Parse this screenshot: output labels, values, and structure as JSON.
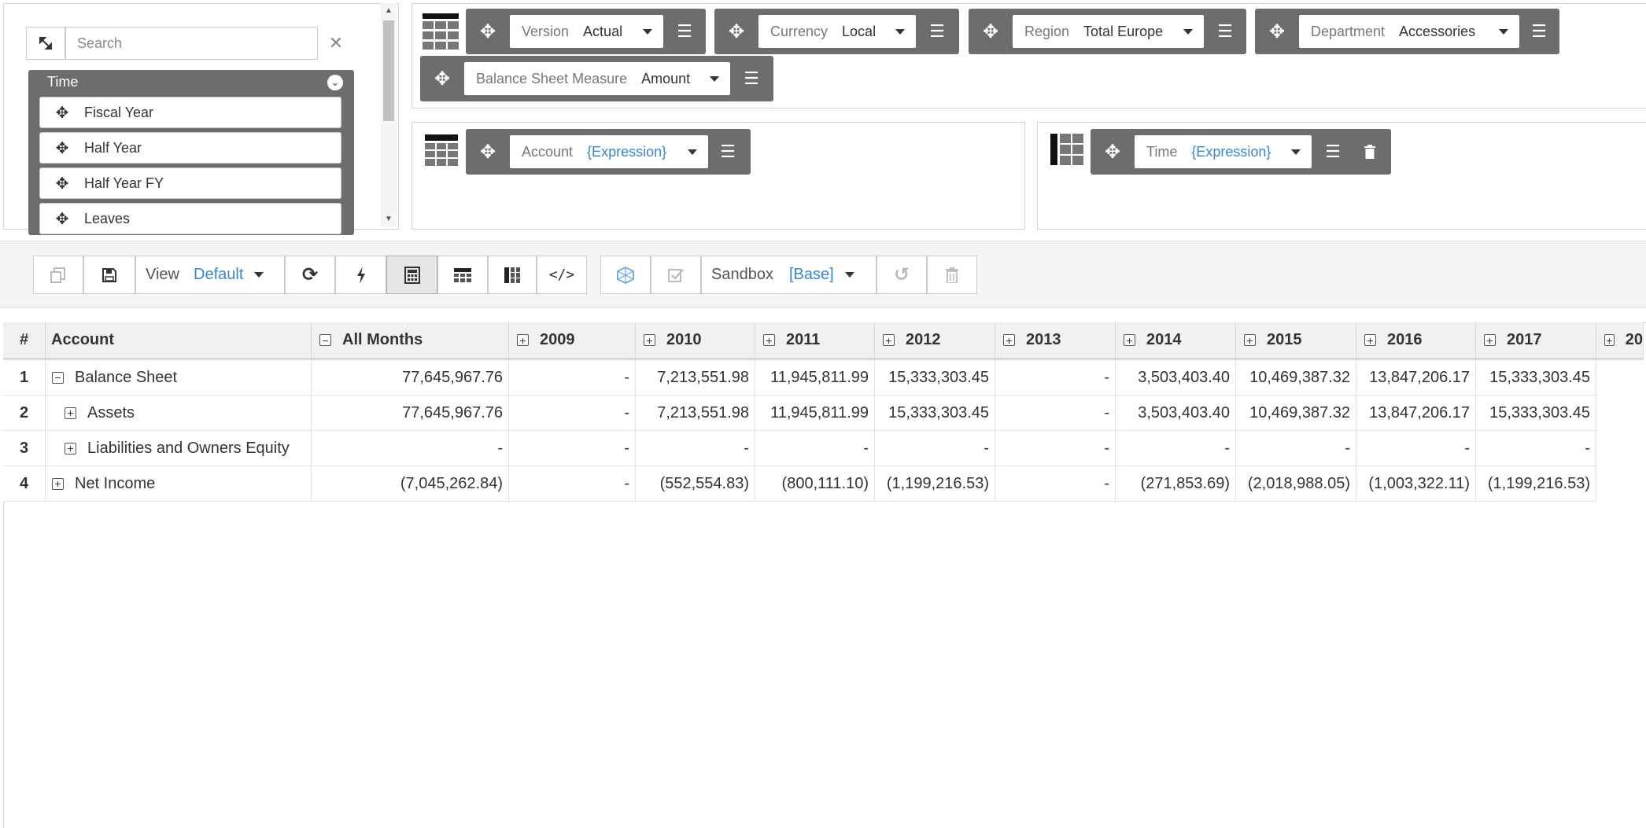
{
  "left_panel": {
    "search_placeholder": "Search",
    "group_title": "Time",
    "items": [
      "Fiscal Year",
      "Half Year",
      "Half Year FY",
      "Leaves"
    ]
  },
  "filters": [
    {
      "label": "Version",
      "value": "Actual"
    },
    {
      "label": "Currency",
      "value": "Local"
    },
    {
      "label": "Region",
      "value": "Total Europe"
    },
    {
      "label": "Department",
      "value": "Accessories"
    },
    {
      "label": "Balance Sheet Measure",
      "value": "Amount"
    }
  ],
  "rows_axis": {
    "label": "Account",
    "value": "{Expression}"
  },
  "cols_axis": {
    "label": "Time",
    "value": "{Expression}"
  },
  "toolbar": {
    "view_label": "View",
    "view_value": "Default",
    "sandbox_label": "Sandbox",
    "sandbox_value": "[Base]"
  },
  "grid": {
    "rownum_header": "#",
    "account_header": "Account",
    "columns": [
      "All Months",
      "2009",
      "2010",
      "2011",
      "2012",
      "2013",
      "2014",
      "2015",
      "2016",
      "2017",
      "20"
    ],
    "rows": [
      {
        "num": "1",
        "name": "Balance Sheet",
        "toggle": "−",
        "indent": 0,
        "values": [
          "77,645,967.76",
          "-",
          "7,213,551.98",
          "11,945,811.99",
          "15,333,303.45",
          "-",
          "3,503,403.40",
          "10,469,387.32",
          "13,847,206.17",
          "15,333,303.45"
        ]
      },
      {
        "num": "2",
        "name": "Assets",
        "toggle": "+",
        "indent": 1,
        "values": [
          "77,645,967.76",
          "-",
          "7,213,551.98",
          "11,945,811.99",
          "15,333,303.45",
          "-",
          "3,503,403.40",
          "10,469,387.32",
          "13,847,206.17",
          "15,333,303.45"
        ]
      },
      {
        "num": "3",
        "name": "Liabilities and Owners Equity",
        "toggle": "+",
        "indent": 1,
        "values": [
          "-",
          "-",
          "-",
          "-",
          "-",
          "-",
          "-",
          "-",
          "-",
          "-"
        ]
      },
      {
        "num": "4",
        "name": "Net Income",
        "toggle": "+",
        "indent": 0,
        "values": [
          "(7,045,262.84)",
          "-",
          "(552,554.83)",
          "(800,111.10)",
          "(1,199,216.53)",
          "-",
          "(271,853.69)",
          "(2,018,988.05)",
          "(1,003,322.11)",
          "(1,199,216.53)"
        ]
      }
    ]
  }
}
